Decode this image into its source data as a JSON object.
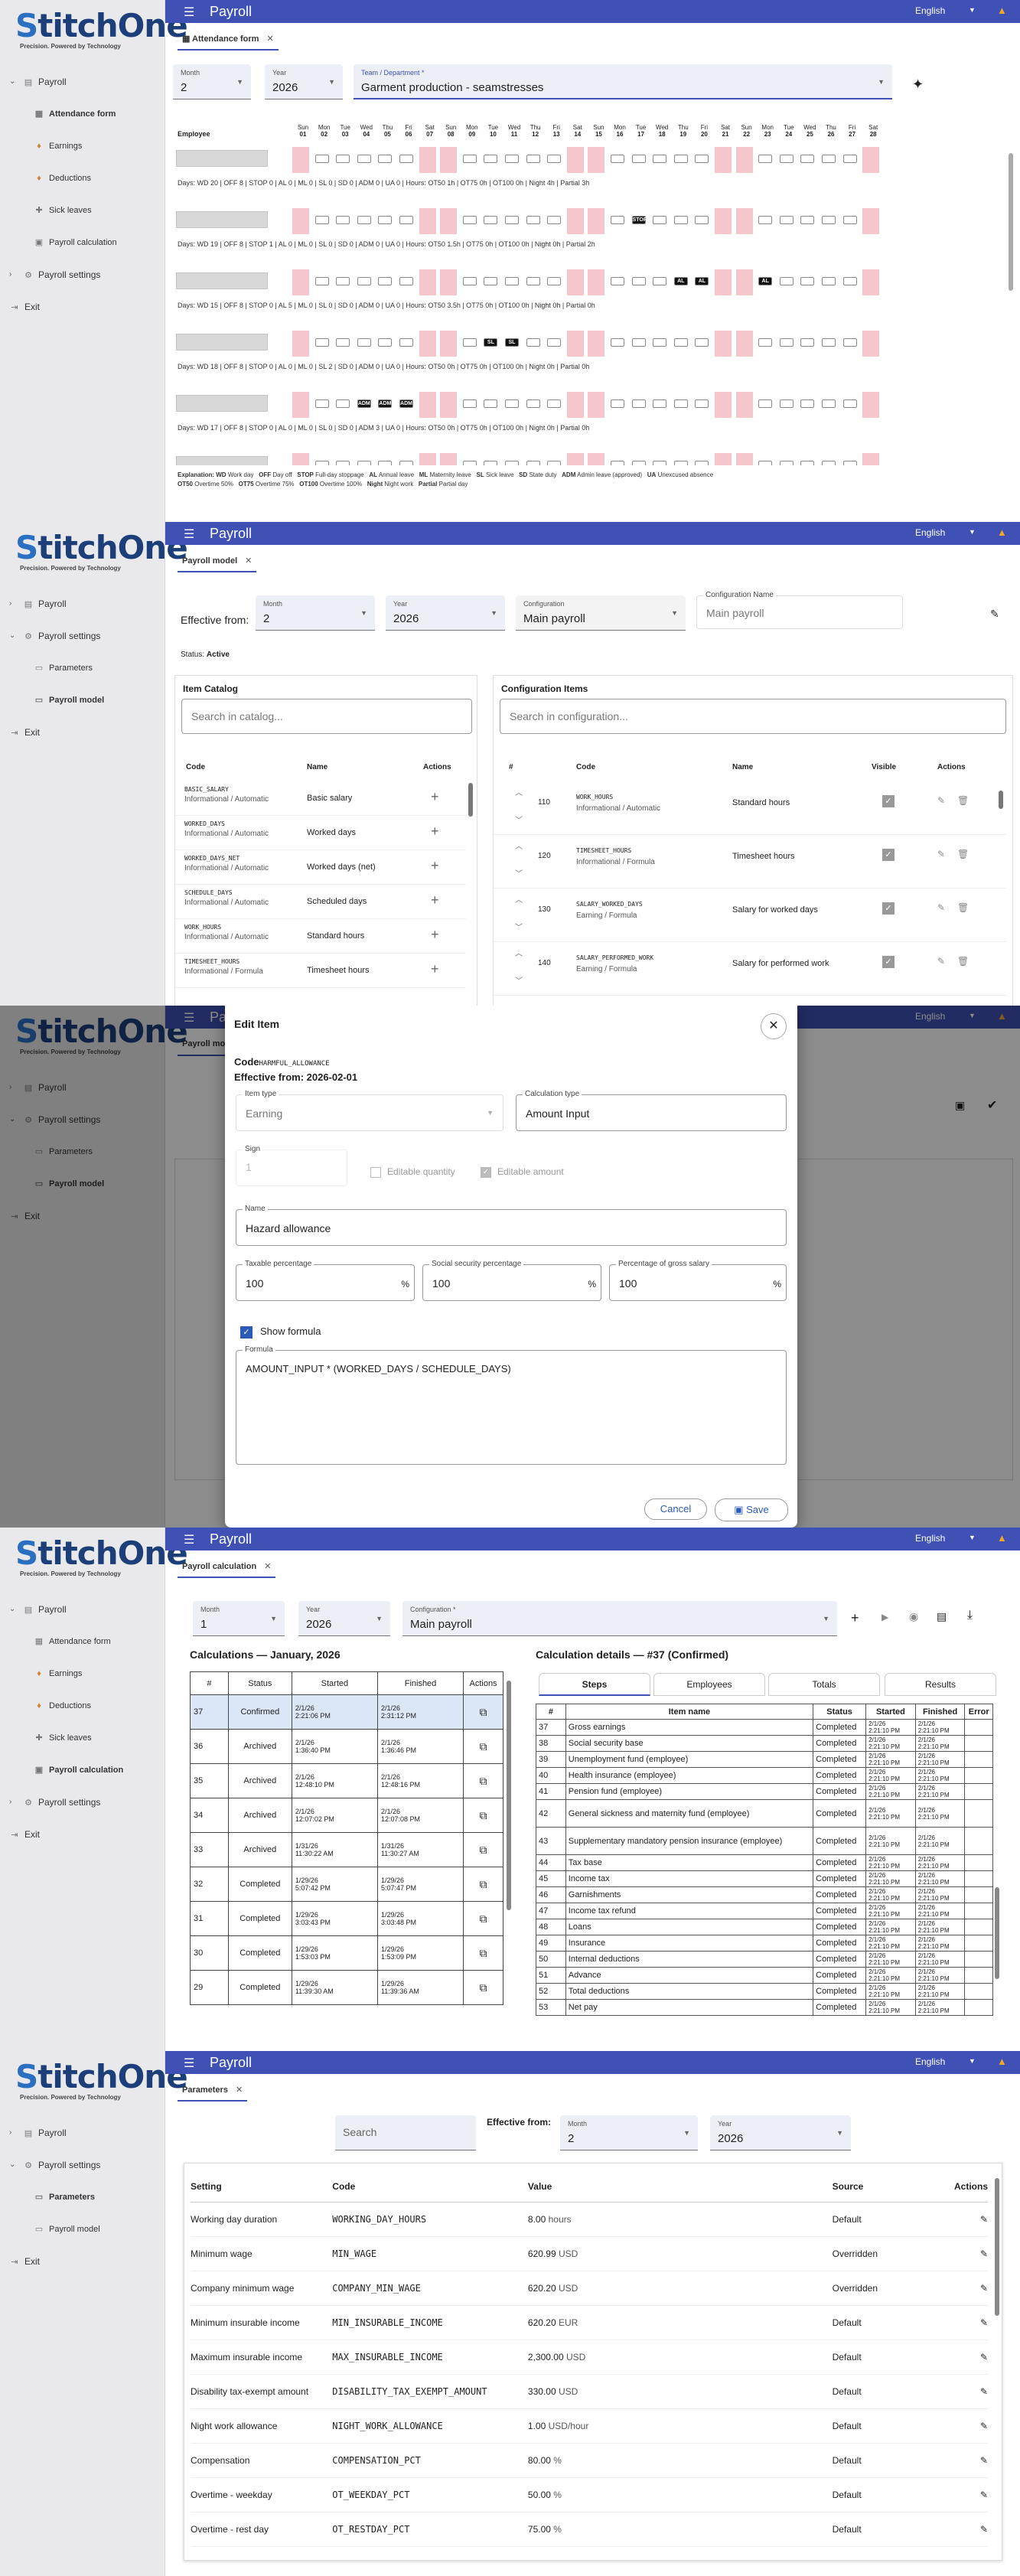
{
  "app": {
    "name": "StitchOne",
    "tagline": "Precision. Powered by Technology",
    "title": "Payroll",
    "language": "English",
    "menu": {
      "payroll": "Payroll",
      "attendance": "Attendance form",
      "earnings": "Earnings",
      "deductions": "Deductions",
      "sick": "Sick leaves",
      "calc": "Payroll calculation",
      "settings": "Payroll settings",
      "parameters": "Parameters",
      "model": "Payroll model",
      "exit": "Exit"
    }
  },
  "attendance": {
    "tab": "Attendance form",
    "month_label": "Month",
    "month": "2",
    "year_label": "Year",
    "year": "2026",
    "team_label": "Team / Department *",
    "team": "Garment production - seamstresses",
    "employee_header": "Employee",
    "days": [
      {
        "d": "Sun",
        "n": "01"
      },
      {
        "d": "Mon",
        "n": "02"
      },
      {
        "d": "Tue",
        "n": "03"
      },
      {
        "d": "Wed",
        "n": "04"
      },
      {
        "d": "Thu",
        "n": "05"
      },
      {
        "d": "Fri",
        "n": "06"
      },
      {
        "d": "Sat",
        "n": "07"
      },
      {
        "d": "Sun",
        "n": "08"
      },
      {
        "d": "Mon",
        "n": "09"
      },
      {
        "d": "Tue",
        "n": "10"
      },
      {
        "d": "Wed",
        "n": "11"
      },
      {
        "d": "Thu",
        "n": "12"
      },
      {
        "d": "Fri",
        "n": "13"
      },
      {
        "d": "Sat",
        "n": "14"
      },
      {
        "d": "Sun",
        "n": "15"
      },
      {
        "d": "Mon",
        "n": "16"
      },
      {
        "d": "Tue",
        "n": "17"
      },
      {
        "d": "Wed",
        "n": "18"
      },
      {
        "d": "Thu",
        "n": "19"
      },
      {
        "d": "Fri",
        "n": "20"
      },
      {
        "d": "Sat",
        "n": "21"
      },
      {
        "d": "Sun",
        "n": "22"
      },
      {
        "d": "Mon",
        "n": "23"
      },
      {
        "d": "Tue",
        "n": "24"
      },
      {
        "d": "Wed",
        "n": "25"
      },
      {
        "d": "Thu",
        "n": "26"
      },
      {
        "d": "Fri",
        "n": "27"
      },
      {
        "d": "Sat",
        "n": "28"
      }
    ],
    "summaries": [
      "Days: WD 20 | OFF 8 | STOP 0 | AL 0 | ML 0 | SL 0 | SD 0 | ADM 0 | UA 0 | Hours: OT50 1h | OT75 0h | OT100 0h | Night 4h | Partial 3h",
      "Days: WD 19 | OFF 8 | STOP 1 | AL 0 | ML 0 | SL 0 | SD 0 | ADM 0 | UA 0 | Hours: OT50 1.5h | OT75 0h | OT100 0h | Night 0h | Partial 2h",
      "Days: WD 15 | OFF 8 | STOP 0 | AL 5 | ML 0 | SL 0 | SD 0 | ADM 0 | UA 0 | Hours: OT50 3.5h | OT75 0h | OT100 0h | Night 0h | Partial 0h",
      "Days: WD 18 | OFF 8 | STOP 0 | AL 0 | ML 0 | SL 2 | SD 0 | ADM 0 | UA 0 | Hours: OT50 0h | OT75 0h | OT100 0h | Night 0h | Partial 0h",
      "Days: WD 17 | OFF 8 | STOP 0 | AL 0 | ML 0 | SL 0 | SD 0 | ADM 3 | UA 0 | Hours: OT50 0h | OT75 0h | OT100 0h | Night 0h | Partial 0h"
    ],
    "special": {
      "stop": "STOP",
      "al": "AL",
      "sl": "SL",
      "adm": "ADM"
    },
    "legend": {
      "title": "Explanation:",
      "items": [
        [
          "WD",
          "Work day"
        ],
        [
          "OFF",
          "Day off"
        ],
        [
          "STOP",
          "Full-day stoppage"
        ],
        [
          "AL",
          "Annual leave"
        ],
        [
          "ML",
          "Maternity leave"
        ],
        [
          "SL",
          "Sick leave"
        ],
        [
          "SD",
          "State duty"
        ],
        [
          "ADM",
          "Admin leave (approved)"
        ],
        [
          "UA",
          "Unexcused absence"
        ],
        [
          "OT50",
          "Overtime 50%"
        ],
        [
          "OT75",
          "Overtime 75%"
        ],
        [
          "OT100",
          "Overtime 100%"
        ],
        [
          "Night",
          "Night work"
        ],
        [
          "Partial",
          "Partial day"
        ]
      ]
    }
  },
  "model": {
    "tab": "Payroll model",
    "effective_label": "Effective from:",
    "month_label": "Month",
    "month": "2",
    "year_label": "Year",
    "year": "2026",
    "config_label": "Configuration",
    "config": "Main payroll",
    "config_name_label": "Configuration Name",
    "config_name": "Main payroll",
    "status_label": "Status:",
    "status": "Active",
    "catalog_title": "Item Catalog",
    "catalog_search": "Search in catalog...",
    "config_title": "Configuration Items",
    "config_search": "Search in configuration...",
    "col_code": "Code",
    "col_name": "Name",
    "col_actions": "Actions",
    "col_num": "#",
    "col_visible": "Visible",
    "catalog": [
      {
        "code": "BASIC_SALARY",
        "type": "Informational / Automatic",
        "name": "Basic salary"
      },
      {
        "code": "WORKED_DAYS",
        "type": "Informational / Automatic",
        "name": "Worked days"
      },
      {
        "code": "WORKED_DAYS_NET",
        "type": "Informational / Automatic",
        "name": "Worked days (net)"
      },
      {
        "code": "SCHEDULE_DAYS",
        "type": "Informational / Automatic",
        "name": "Scheduled days"
      },
      {
        "code": "WORK_HOURS",
        "type": "Informational / Automatic",
        "name": "Standard hours"
      },
      {
        "code": "TIMESHEET_HOURS",
        "type": "Informational / Formula",
        "name": "Timesheet hours"
      }
    ],
    "config_items": [
      {
        "n": "110",
        "code": "WORK_HOURS",
        "type": "Informational / Automatic",
        "name": "Standard hours"
      },
      {
        "n": "120",
        "code": "TIMESHEET_HOURS",
        "type": "Informational / Formula",
        "name": "Timesheet hours"
      },
      {
        "n": "130",
        "code": "SALARY_WORKED_DAYS",
        "type": "Earning / Formula",
        "name": "Salary for worked days"
      },
      {
        "n": "140",
        "code": "SALARY_PERFORMED_WORK",
        "type": "Earning / Formula",
        "name": "Salary for performed work"
      }
    ]
  },
  "edit": {
    "title": "Edit Item",
    "code_label": "Code",
    "code": "HARMFUL_ALLOWANCE",
    "effective": "Effective from: 2026-02-01",
    "item_type_label": "Item type",
    "item_type": "Earning",
    "calc_type_label": "Calculation type",
    "calc_type": "Amount Input",
    "sign_label": "Sign",
    "sign": "1",
    "editable_qty": "Editable quantity",
    "editable_amt": "Editable amount",
    "name_label": "Name",
    "name": "Hazard allowance",
    "taxable_label": "Taxable percentage",
    "taxable": "100",
    "ss_label": "Social security percentage",
    "ss": "100",
    "gross_label": "Percentage of gross salary",
    "gross": "100",
    "pct": "%",
    "show_formula": "Show formula",
    "formula_label": "Formula",
    "formula": "AMOUNT_INPUT * (WORKED_DAYS / SCHEDULE_DAYS)",
    "cancel": "Cancel",
    "save": "Save"
  },
  "calc": {
    "tab": "Payroll calculation",
    "month_label": "Month",
    "month": "1",
    "year_label": "Year",
    "year": "2026",
    "config_label": "Configuration *",
    "config": "Main payroll",
    "list_title": "Calculations — January, 2026",
    "details_title": "Calculation details — #37 (Confirmed)",
    "cols": [
      "#",
      "Status",
      "Started",
      "Finished",
      "Actions"
    ],
    "rows": [
      {
        "n": "37",
        "status": "Confirmed",
        "s1": "2/1/26",
        "s2": "2:21:06 PM",
        "f1": "2/1/26",
        "f2": "2:31:12 PM"
      },
      {
        "n": "36",
        "status": "Archived",
        "s1": "2/1/26",
        "s2": "1:36:40 PM",
        "f1": "2/1/26",
        "f2": "1:36:46 PM"
      },
      {
        "n": "35",
        "status": "Archived",
        "s1": "2/1/26",
        "s2": "12:48:10 PM",
        "f1": "2/1/26",
        "f2": "12:48:16 PM"
      },
      {
        "n": "34",
        "status": "Archived",
        "s1": "2/1/26",
        "s2": "12:07:02 PM",
        "f1": "2/1/26",
        "f2": "12:07:08 PM"
      },
      {
        "n": "33",
        "status": "Archived",
        "s1": "1/31/26",
        "s2": "11:30:22 AM",
        "f1": "1/31/26",
        "f2": "11:30:27 AM"
      },
      {
        "n": "32",
        "status": "Completed",
        "s1": "1/29/26",
        "s2": "5:07:42 PM",
        "f1": "1/29/26",
        "f2": "5:07:47 PM"
      },
      {
        "n": "31",
        "status": "Completed",
        "s1": "1/29/26",
        "s2": "3:03:43 PM",
        "f1": "1/29/26",
        "f2": "3:03:48 PM"
      },
      {
        "n": "30",
        "status": "Completed",
        "s1": "1/29/26",
        "s2": "1:53:03 PM",
        "f1": "1/29/26",
        "f2": "1:53:09 PM"
      },
      {
        "n": "29",
        "status": "Completed",
        "s1": "1/29/26",
        "s2": "11:39:30 AM",
        "f1": "1/29/26",
        "f2": "11:39:36 AM"
      }
    ],
    "dtabs": [
      "Steps",
      "Employees",
      "Totals",
      "Results"
    ],
    "dcols": [
      "#",
      "Item name",
      "Status",
      "Started",
      "Finished",
      "Error"
    ],
    "steps": [
      {
        "n": "37",
        "name": "Gross earnings",
        "st": "Completed"
      },
      {
        "n": "38",
        "name": "Social security base",
        "st": "Completed"
      },
      {
        "n": "39",
        "name": "Unemployment fund (employee)",
        "st": "Completed"
      },
      {
        "n": "40",
        "name": "Health insurance (employee)",
        "st": "Completed"
      },
      {
        "n": "41",
        "name": "Pension fund (employee)",
        "st": "Completed"
      },
      {
        "n": "42",
        "name": "General sickness and maternity fund (employee)",
        "st": "Completed"
      },
      {
        "n": "43",
        "name": "Supplementary mandatory pension insurance (employee)",
        "st": "Completed"
      },
      {
        "n": "44",
        "name": "Tax base",
        "st": "Completed"
      },
      {
        "n": "45",
        "name": "Income tax",
        "st": "Completed"
      },
      {
        "n": "46",
        "name": "Garnishments",
        "st": "Completed"
      },
      {
        "n": "47",
        "name": "Income tax refund",
        "st": "Completed"
      },
      {
        "n": "48",
        "name": "Loans",
        "st": "Completed"
      },
      {
        "n": "49",
        "name": "Insurance",
        "st": "Completed"
      },
      {
        "n": "50",
        "name": "Internal deductions",
        "st": "Completed"
      },
      {
        "n": "51",
        "name": "Advance",
        "st": "Completed"
      },
      {
        "n": "52",
        "name": "Total deductions",
        "st": "Completed"
      },
      {
        "n": "53",
        "name": "Net pay",
        "st": "Completed"
      }
    ],
    "step_date": "2/1/26",
    "step_time": "2:21:10 PM"
  },
  "params": {
    "tab": "Parameters",
    "search": "Search",
    "effective_label": "Effective from:",
    "month_label": "Month",
    "month": "2",
    "year_label": "Year",
    "year": "2026",
    "cols": [
      "Setting",
      "Code",
      "Value",
      "Source",
      "Actions"
    ],
    "rows": [
      {
        "s": "Working day duration",
        "c": "WORKING_DAY_HOURS",
        "v": "8.00",
        "u": "hours",
        "src": "Default"
      },
      {
        "s": "Minimum wage",
        "c": "MIN_WAGE",
        "v": "620.99",
        "u": "USD",
        "src": "Overridden"
      },
      {
        "s": "Company minimum wage",
        "c": "COMPANY_MIN_WAGE",
        "v": "620.20",
        "u": "USD",
        "src": "Overridden"
      },
      {
        "s": "Minimum insurable income",
        "c": "MIN_INSURABLE_INCOME",
        "v": "620.20",
        "u": "EUR",
        "src": "Default"
      },
      {
        "s": "Maximum insurable income",
        "c": "MAX_INSURABLE_INCOME",
        "v": "2,300.00",
        "u": "USD",
        "src": "Default"
      },
      {
        "s": "Disability tax-exempt amount",
        "c": "DISABILITY_TAX_EXEMPT_AMOUNT",
        "v": "330.00",
        "u": "USD",
        "src": "Default"
      },
      {
        "s": "Night work allowance",
        "c": "NIGHT_WORK_ALLOWANCE",
        "v": "1.00",
        "u": "USD/hour",
        "src": "Default"
      },
      {
        "s": "Compensation",
        "c": "COMPENSATION_PCT",
        "v": "80.00",
        "u": "%",
        "src": "Default"
      },
      {
        "s": "Overtime - weekday",
        "c": "OT_WEEKDAY_PCT",
        "v": "50.00",
        "u": "%",
        "src": "Default"
      },
      {
        "s": "Overtime - rest day",
        "c": "OT_RESTDAY_PCT",
        "v": "75.00",
        "u": "%",
        "src": "Default"
      }
    ]
  }
}
